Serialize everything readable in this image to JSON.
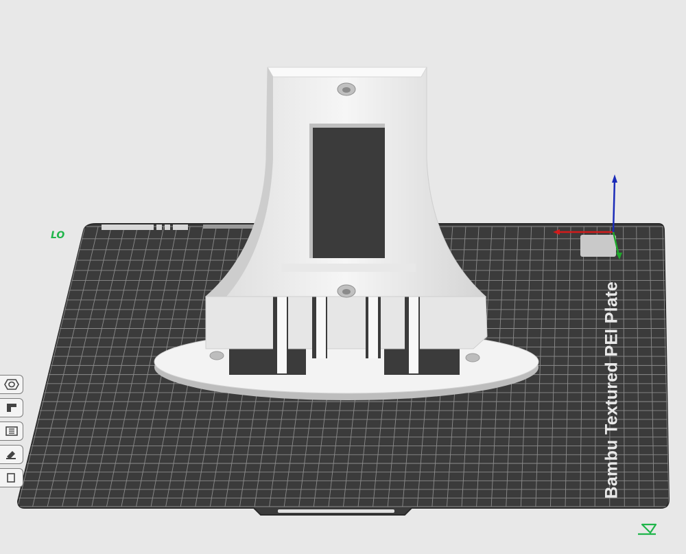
{
  "plate": {
    "label": "Bambu Textured PEI Plate",
    "number": "LO"
  },
  "toolbar": {
    "items": [
      {
        "icon": "nut-icon"
      },
      {
        "icon": "support-icon"
      },
      {
        "icon": "seam-icon"
      },
      {
        "icon": "paint-icon"
      },
      {
        "icon": "measure-icon"
      }
    ]
  },
  "colors": {
    "plate": "#3b3b3b",
    "grid": "#8c8c8c",
    "model": "#f2f2f2",
    "axis_x": "#d41b1b",
    "axis_y": "#1fa82c",
    "axis_z": "#1a2bb8",
    "plate_number": "#1fb54a"
  },
  "corner_icon": "assemble-view-icon"
}
